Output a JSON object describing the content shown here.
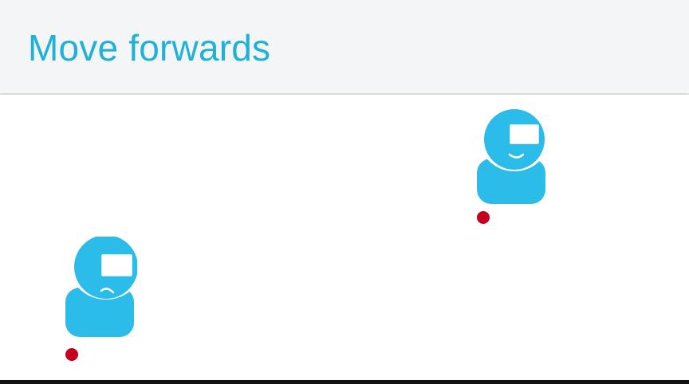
{
  "header": {
    "title": "Move forwards"
  },
  "colors": {
    "title": "#1fb1d8",
    "avatar": "#2bbcea",
    "marker": "#c4001e",
    "header_bg": "#f4f5f7"
  },
  "scene": {
    "figures": [
      {
        "icon": "vr-headset-person-icon",
        "expression": "frown"
      },
      {
        "icon": "vr-headset-person-icon",
        "expression": "smile"
      }
    ],
    "markers": [
      {
        "icon": "position-dot"
      },
      {
        "icon": "position-dot"
      }
    ]
  }
}
